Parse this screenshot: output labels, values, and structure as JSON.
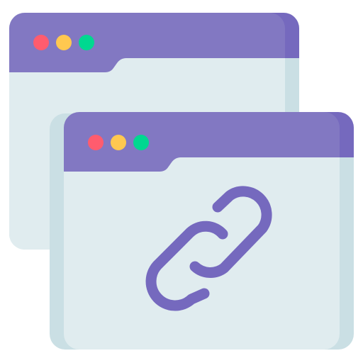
{
  "colors": {
    "background": "#ffffff",
    "titlebar": "#8278C2",
    "titlebar_shade": "#7569BE",
    "window_body": "#E0ECEF",
    "window_body_shade": "#CADFE4",
    "dot_red": "#FF5C6E",
    "dot_yellow": "#FFC850",
    "dot_green": "#00D890",
    "link": "#7569BE"
  },
  "icons": {
    "back_window": "browser-window-icon",
    "front_window": "browser-window-icon",
    "link": "link-chain-icon",
    "window_controls": [
      "close-dot-icon",
      "minimize-dot-icon",
      "maximize-dot-icon"
    ]
  }
}
